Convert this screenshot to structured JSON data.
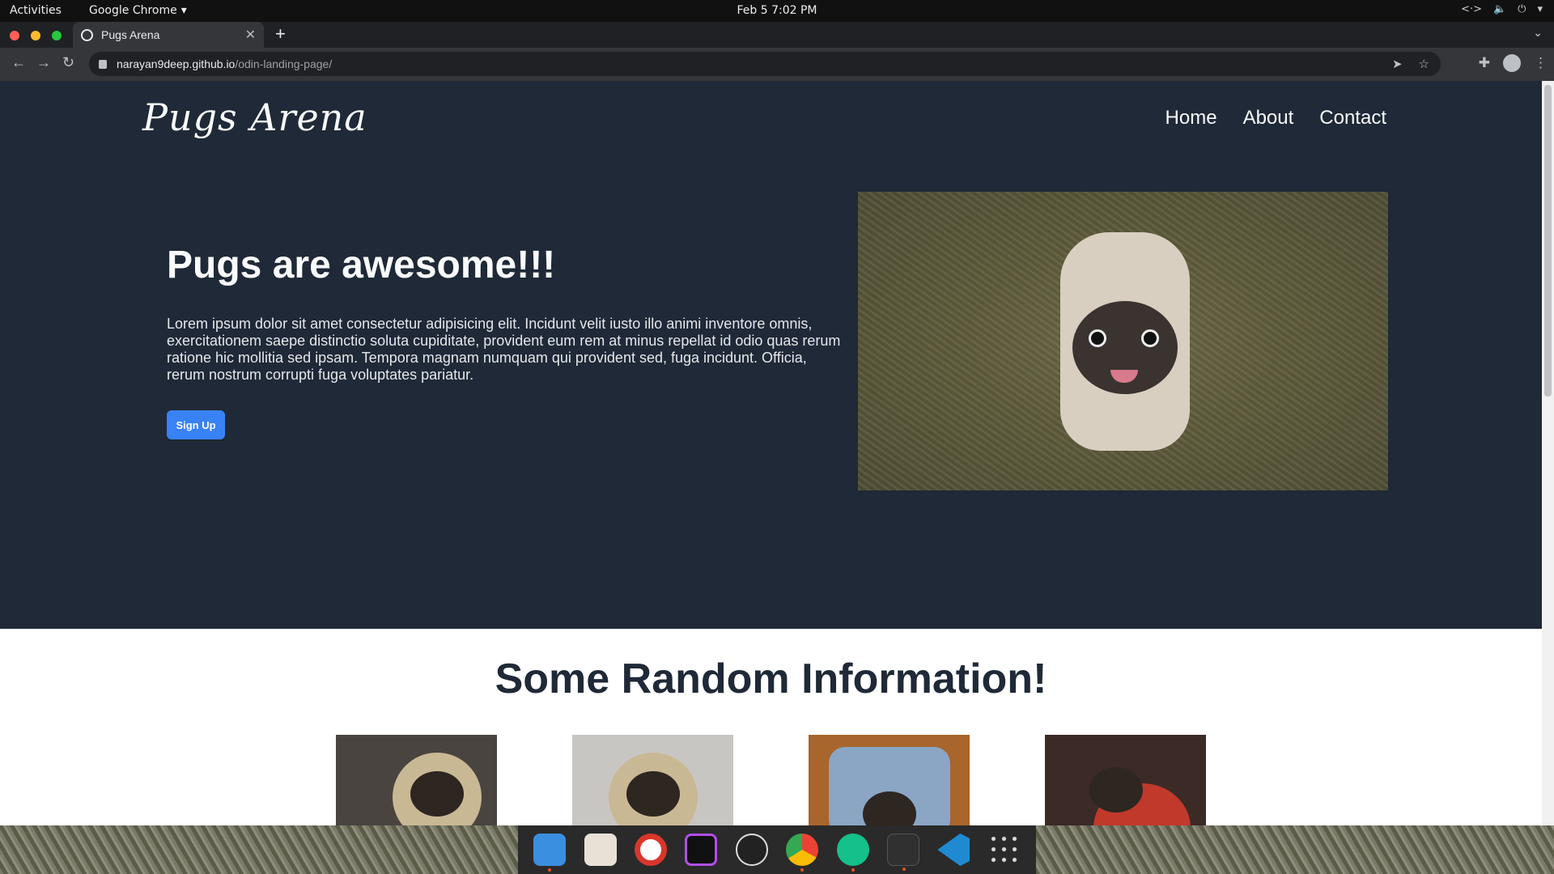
{
  "system": {
    "activities": "Activities",
    "app_menu": "Google Chrome",
    "clock": "Feb 5  7:02 PM"
  },
  "browser": {
    "tab_title": "Pugs Arena",
    "url_host": "narayan9deep.github.io",
    "url_path": "/odin-landing-page/"
  },
  "page": {
    "logo": "Pugs Arena",
    "nav": [
      "Home",
      "About",
      "Contact"
    ],
    "hero_title": "Pugs are awesome!!!",
    "hero_text": "Lorem ipsum dolor sit amet consectetur adipisicing elit. Incidunt velit iusto illo animi inventore omnis, exercitationem saepe distinctio soluta cupiditate, provident eum rem at minus repellat id odio quas rerum ratione hic mollitia sed ipsam. Tempora magnam numquam qui provident sed, fuga incidunt. Officia, rerum nostrum corrupti fuga voluptates pariatur.",
    "signup_label": "Sign Up",
    "info_title": "Some Random Information!"
  },
  "colors": {
    "hero_bg": "#1f2937",
    "button": "#3882f6"
  },
  "dock_apps": [
    "finder",
    "installer",
    "help",
    "intellij",
    "obs",
    "chrome",
    "updater",
    "terminal",
    "vscode",
    "app-grid"
  ]
}
